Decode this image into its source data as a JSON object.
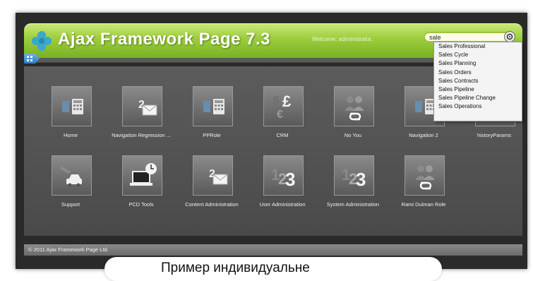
{
  "header": {
    "title": "Ajax Framework Page 7.3",
    "welcome": "Welcome: administrator,",
    "search_value": "sale",
    "colors": {
      "accent": "#8cc234",
      "title": "#ffffff"
    }
  },
  "suggestions": [
    "Sales Professional",
    "Sales Cycle",
    "Sales Planning",
    "Sales Orders",
    "Sales Contracts",
    "Sales Pipeline",
    "Sales Pipeline Change",
    "Sales Operations"
  ],
  "tiles_row1": [
    {
      "label": "Home",
      "icon": "calculator-icon"
    },
    {
      "label": "Navigation Regression ...",
      "icon": "envelope-123-icon"
    },
    {
      "label": "PPRole",
      "icon": "calculator-icon"
    },
    {
      "label": "CRM",
      "icon": "currency-icon"
    },
    {
      "label": "No You",
      "icon": "people-exchange-icon"
    },
    {
      "label": "Navigation 2",
      "icon": "calculator-icon"
    },
    {
      "label": "historyParams",
      "icon": "calculator-icon"
    }
  ],
  "tiles_row2": [
    {
      "label": "Support",
      "icon": "plane-car-icon"
    },
    {
      "label": "PCD Tools",
      "icon": "laptop-clock-icon"
    },
    {
      "label": "Content Administration",
      "icon": "envelope-123-icon"
    },
    {
      "label": "User Administration",
      "icon": "numbers-123-icon"
    },
    {
      "label": "System Administration",
      "icon": "numbers-123-icon"
    },
    {
      "label": "Rami Dulman Role",
      "icon": "people-exchange-icon"
    }
  ],
  "footer": {
    "text": "© 2011 Ajax Framework Page Ltd."
  },
  "overlay": {
    "text": "Пример индивидуальне"
  }
}
